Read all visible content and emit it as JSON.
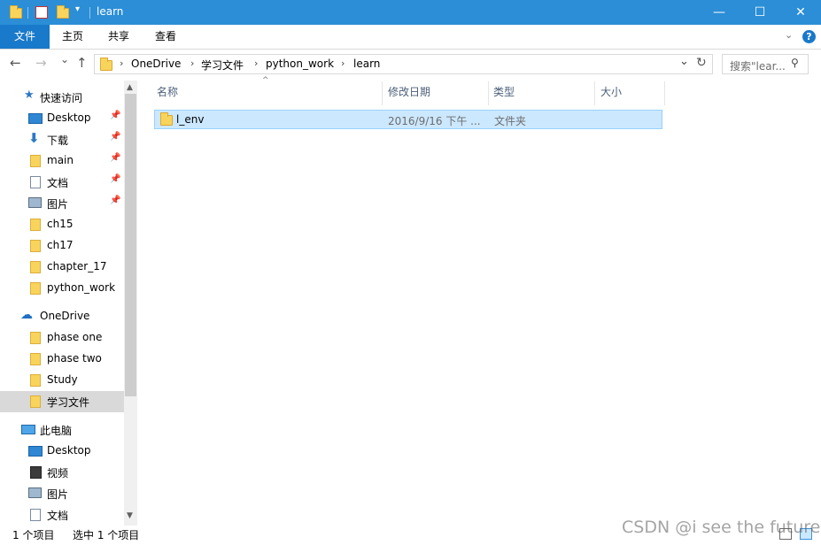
{
  "window": {
    "title": "learn",
    "minimize": "—",
    "maximize": "☐",
    "close": "✕"
  },
  "ribbon": {
    "tabs": [
      "文件",
      "主页",
      "共享",
      "查看"
    ],
    "expand_chevron": "chevron-down-icon",
    "help": "?"
  },
  "address": {
    "breadcrumbs": [
      "OneDrive",
      "学习文件",
      "python_work",
      "learn"
    ],
    "search_placeholder": "搜索\"lear...",
    "nav_back": "←",
    "nav_forward": "→",
    "nav_recent": "⌄",
    "nav_up": "↑",
    "refresh": "↻",
    "dropdown": "⌄"
  },
  "nav_pane": {
    "items": [
      {
        "label": "快速访问",
        "icon": "star-icon",
        "pinned": false
      },
      {
        "label": "Desktop",
        "icon": "desktop-icon",
        "pinned": true
      },
      {
        "label": "下载",
        "icon": "download-icon",
        "pinned": true
      },
      {
        "label": "main",
        "icon": "folder-icon",
        "pinned": true
      },
      {
        "label": "文档",
        "icon": "document-icon",
        "pinned": true
      },
      {
        "label": "图片",
        "icon": "picture-icon",
        "pinned": true
      },
      {
        "label": "ch15",
        "icon": "folder-icon",
        "pinned": false
      },
      {
        "label": "ch17",
        "icon": "folder-icon",
        "pinned": false
      },
      {
        "label": "chapter_17",
        "icon": "folder-icon",
        "pinned": false
      },
      {
        "label": "python_work",
        "icon": "folder-icon",
        "pinned": false
      },
      {
        "label": "OneDrive",
        "icon": "cloud-icon",
        "pinned": false
      },
      {
        "label": "phase one",
        "icon": "folder-icon",
        "pinned": false
      },
      {
        "label": "phase two",
        "icon": "folder-icon",
        "pinned": false
      },
      {
        "label": "Study",
        "icon": "folder-icon",
        "pinned": false
      },
      {
        "label": "学习文件",
        "icon": "folder-icon",
        "pinned": false,
        "selected": true
      },
      {
        "label": "此电脑",
        "icon": "computer-icon",
        "pinned": false
      },
      {
        "label": "Desktop",
        "icon": "desktop-icon",
        "pinned": false
      },
      {
        "label": "视频",
        "icon": "video-icon",
        "pinned": false
      },
      {
        "label": "图片",
        "icon": "picture-icon",
        "pinned": false
      },
      {
        "label": "文档",
        "icon": "document-icon",
        "pinned": false
      }
    ]
  },
  "columns": {
    "name": "名称",
    "modified": "修改日期",
    "type": "类型",
    "size": "大小"
  },
  "files": [
    {
      "name": "l_env",
      "modified": "2016/9/16 下午 ...",
      "type": "文件夹",
      "size": ""
    }
  ],
  "status": {
    "item_count": "1 个项目",
    "selected": "选中 1 个项目"
  },
  "watermark": "CSDN @i see the future",
  "colors": {
    "titlebar": "#2b8ed6",
    "file_tab": "#1979ca",
    "selection": "#cce8ff",
    "selection_border": "#99d1ff",
    "folder": "#f9d45c"
  }
}
